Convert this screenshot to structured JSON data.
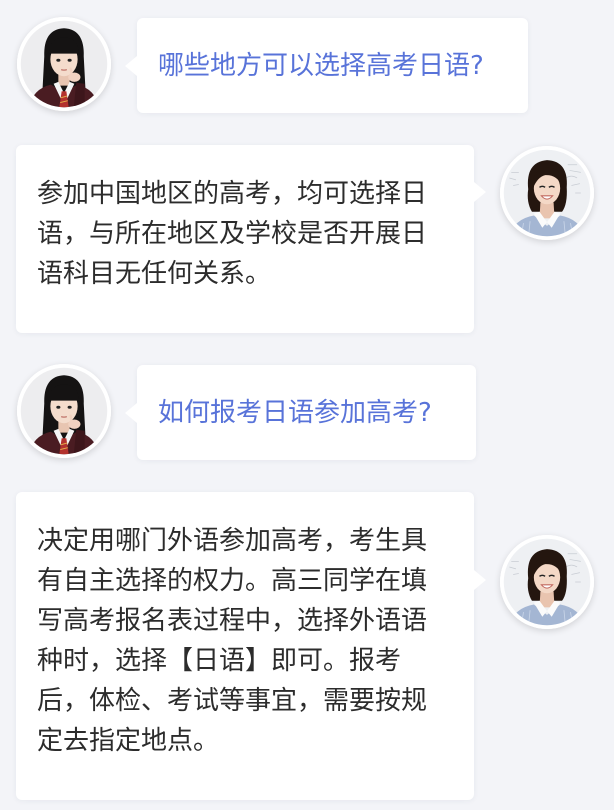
{
  "colors": {
    "background": "#f3f4f8",
    "bubble": "#ffffff",
    "question_text": "#5873d9",
    "answer_text": "#2c2c2c"
  },
  "messages": [
    {
      "role": "student",
      "avatar_icon": "student-avatar",
      "text": "哪些地方可以选择高考日语?"
    },
    {
      "role": "teacher",
      "avatar_icon": "teacher-avatar",
      "text": "参加中国地区的高考，均可选择日语，与所在地区及学校是否开展日语科目无任何关系。"
    },
    {
      "role": "student",
      "avatar_icon": "student-avatar",
      "text": "如何报考日语参加高考?"
    },
    {
      "role": "teacher",
      "avatar_icon": "teacher-avatar",
      "text": "决定用哪门外语参加高考，考生具有自主选择的权力。高三同学在填写高考报名表过程中，选择外语语种时，选择【日语】即可。报考后，体检、考试等事宜，需要按规定去指定地点。"
    }
  ]
}
